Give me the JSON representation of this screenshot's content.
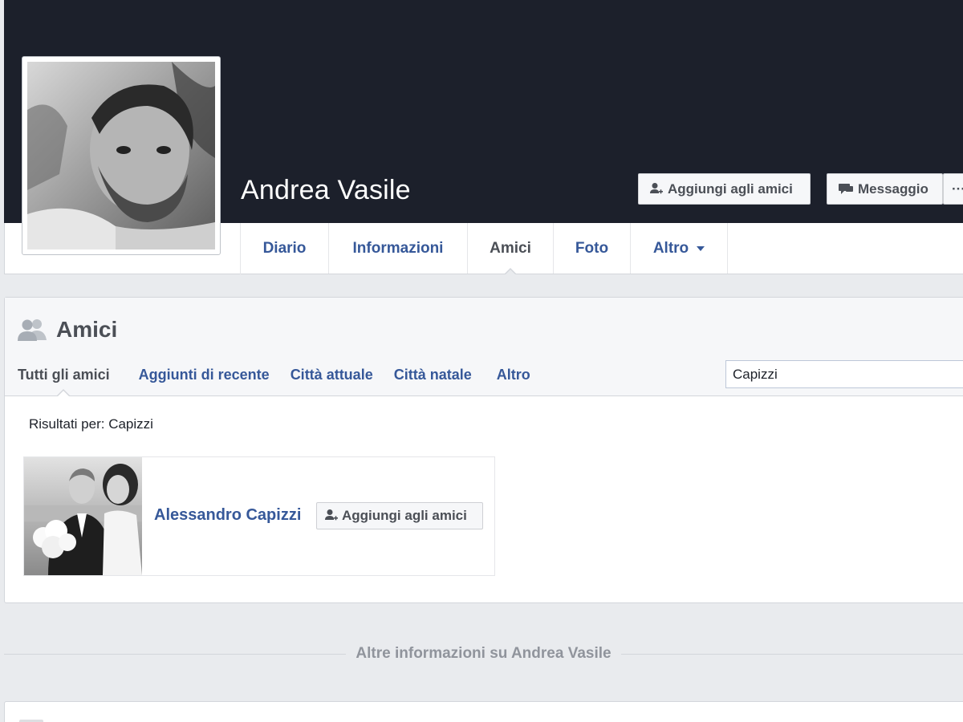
{
  "profile": {
    "name": "Andrea Vasile",
    "add_friend_label": "Aggiungi agli amici",
    "message_label": "Messaggio",
    "more_label": "···"
  },
  "tabs": [
    {
      "label": "Diario",
      "active": false
    },
    {
      "label": "Informazioni",
      "active": false
    },
    {
      "label": "Amici",
      "active": true
    },
    {
      "label": "Foto",
      "active": false
    },
    {
      "label": "Altro",
      "active": false
    }
  ],
  "friends": {
    "title": "Amici",
    "subtabs": [
      {
        "label": "Tutti gli amici",
        "active": true
      },
      {
        "label": "Aggiunti di recente",
        "active": false
      },
      {
        "label": "Città attuale",
        "active": false
      },
      {
        "label": "Città natale",
        "active": false
      },
      {
        "label": "Altro",
        "active": false
      }
    ],
    "search_value": "Capizzi",
    "results_label": "Risultati per: Capizzi",
    "items": [
      {
        "name": "Alessandro Capizzi",
        "add_label": "Aggiungi agli amici"
      }
    ]
  },
  "more_info": "Altre informazioni su Andrea Vasile",
  "colors": {
    "link": "#365899",
    "cover": "#1c202b",
    "page_bg": "#e9ebee"
  }
}
